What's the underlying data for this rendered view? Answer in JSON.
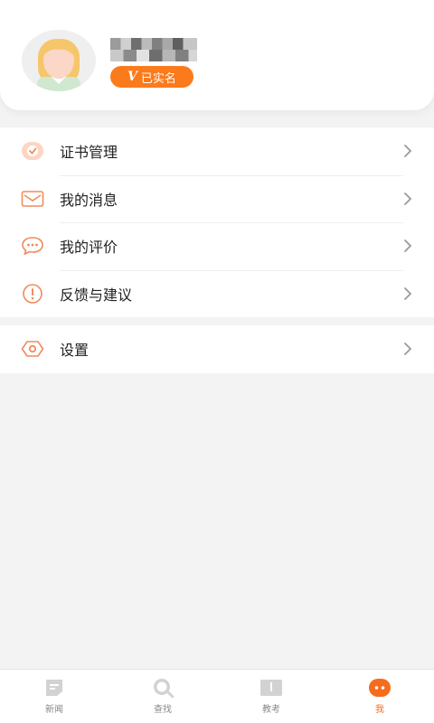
{
  "profile": {
    "username": "",
    "verified_label": "已实名",
    "verified_mark": "V"
  },
  "menu": [
    {
      "label": "证书管理",
      "icon": "certificate-icon"
    },
    {
      "label": "我的消息",
      "icon": "envelope-icon"
    },
    {
      "label": "我的评价",
      "icon": "comment-icon"
    },
    {
      "label": "反馈与建议",
      "icon": "alert-icon"
    }
  ],
  "settings": {
    "label": "设置",
    "icon": "eye-settings-icon"
  },
  "tabs": [
    {
      "label": "新闻",
      "icon": "news-icon",
      "active": false
    },
    {
      "label": "查找",
      "icon": "search-icon",
      "active": false
    },
    {
      "label": "教考",
      "icon": "book-icon",
      "active": false
    },
    {
      "label": "我",
      "icon": "profile-icon",
      "active": true
    }
  ],
  "colors": {
    "accent": "#fb7a1c",
    "active_tab": "#f56c1d",
    "icon_light": "#fcd6c5",
    "background": "#f3f3f3"
  }
}
